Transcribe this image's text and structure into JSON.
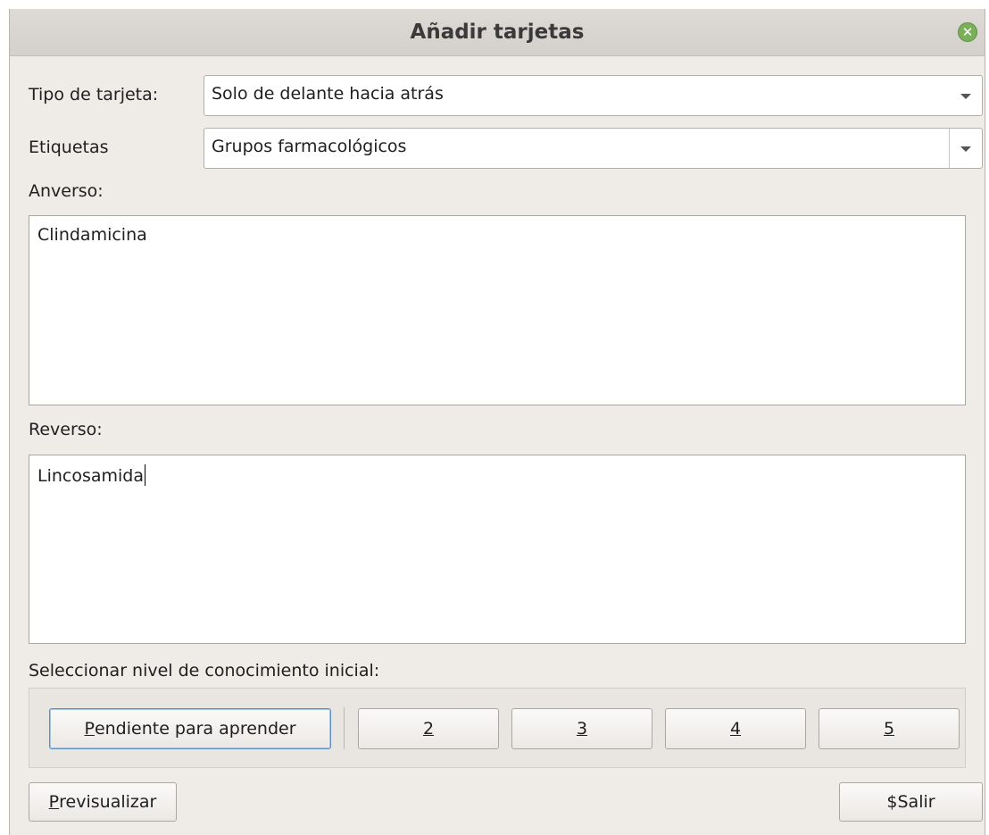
{
  "window": {
    "title": "Añadir tarjetas",
    "close_icon": "close-icon"
  },
  "card_type": {
    "label": "Tipo de tarjeta:",
    "value": "Solo de delante hacia atrás"
  },
  "tags": {
    "label": "Etiquetas",
    "value": "Grupos farmacológicos"
  },
  "front": {
    "label": "Anverso:",
    "value": "Clindamicina"
  },
  "back": {
    "label": "Reverso:",
    "value": "Lincosamida"
  },
  "grades": {
    "label": "Seleccionar nivel de conocimiento inicial:",
    "buttons": [
      {
        "mnemonic": "P",
        "rest": "endiente para aprender"
      },
      {
        "mnemonic": "2",
        "rest": ""
      },
      {
        "mnemonic": "3",
        "rest": ""
      },
      {
        "mnemonic": "4",
        "rest": ""
      },
      {
        "mnemonic": "5",
        "rest": ""
      }
    ]
  },
  "footer": {
    "preview_mnemonic": "P",
    "preview_rest": "revisualizar",
    "exit_label": "$Salir"
  }
}
